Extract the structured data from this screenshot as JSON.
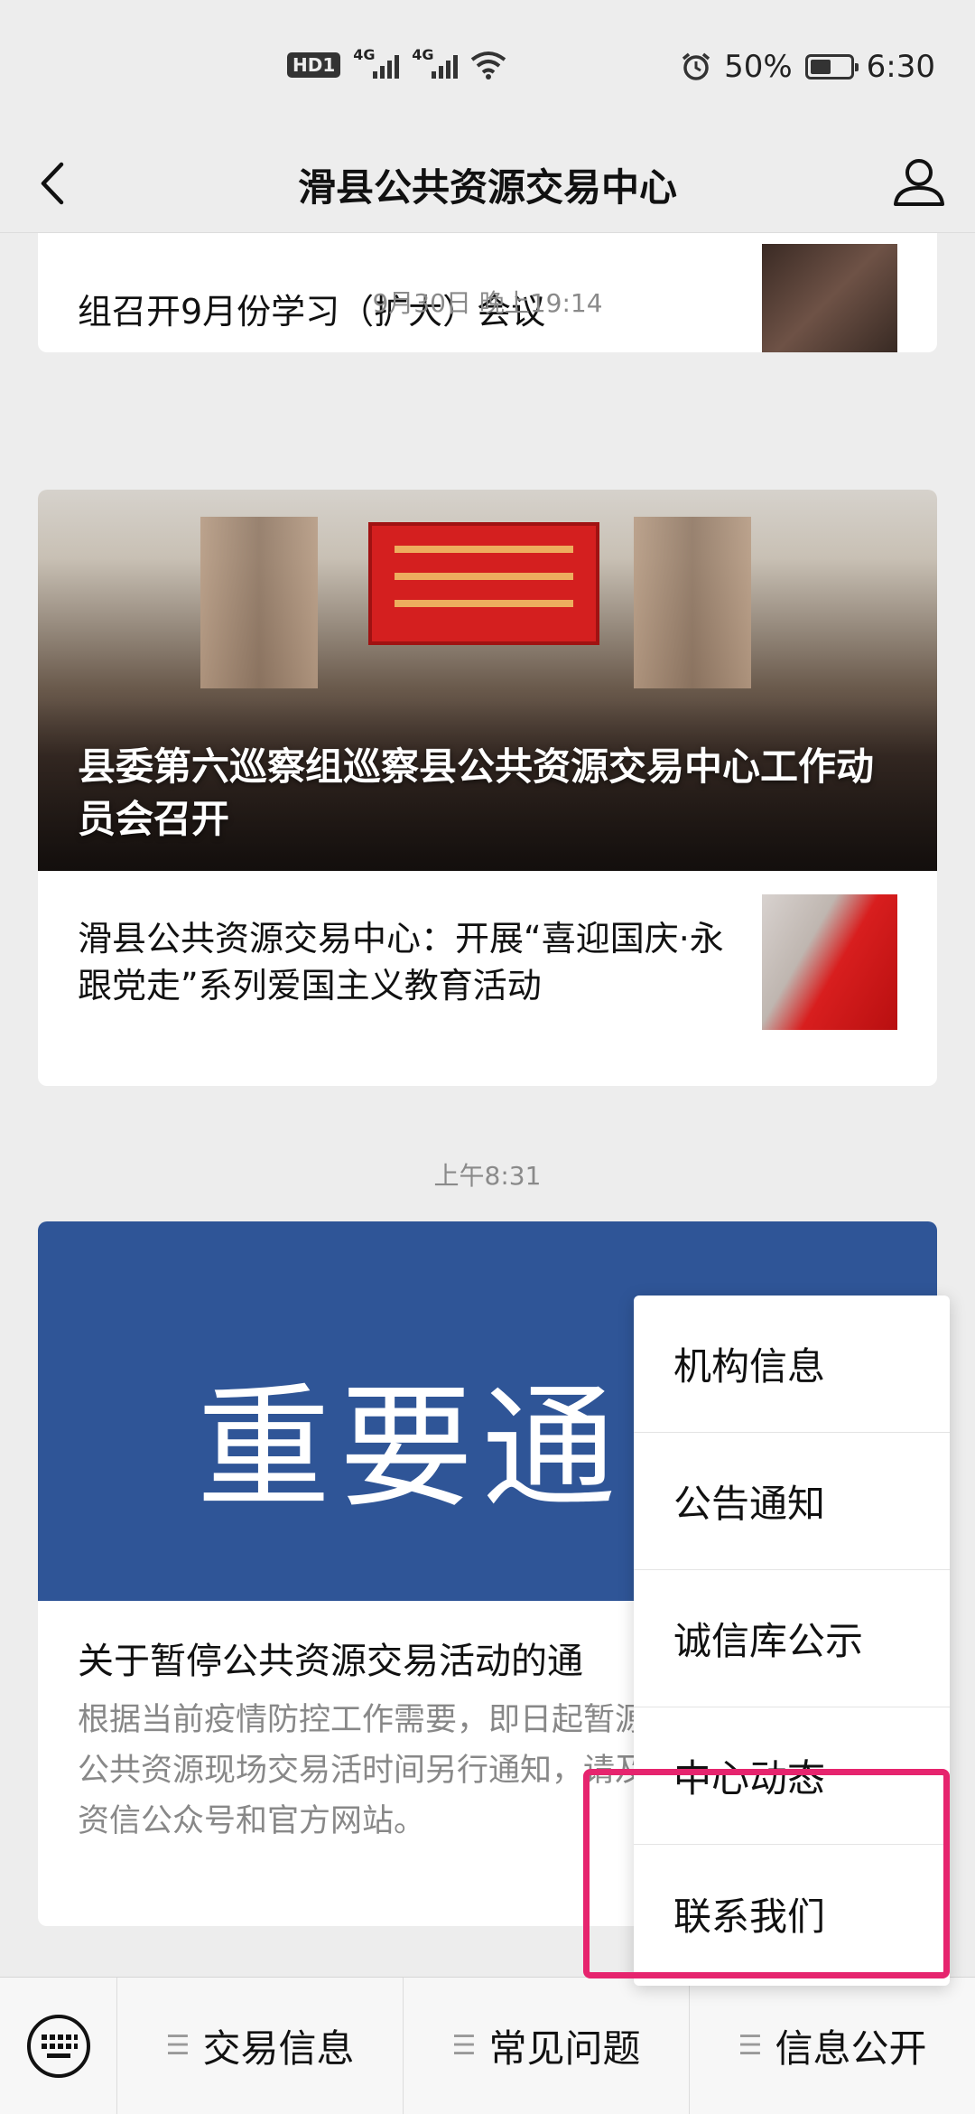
{
  "status_bar": {
    "hd_label": "HD",
    "sim_label": "1",
    "network_1": "4G",
    "network_2": "4G",
    "battery": "50%",
    "battery_level": 0.5,
    "time": "6:30",
    "icons": [
      "signal-icon",
      "wifi-icon",
      "alarm-icon",
      "battery-icon"
    ]
  },
  "nav": {
    "title": "滑县公共资源交易中心"
  },
  "feed": {
    "card1": {
      "title": "组召开9月份学习（扩大）会议"
    },
    "timestamp1": "9月30日 晚上19:14",
    "card2": {
      "hero_caption": "县委第六巡察组巡察县公共资源交易中心工作动员会召开",
      "item_title": "滑县公共资源交易中心：开展“喜迎国庆·永跟党走”系列爱国主义教育活动"
    },
    "timestamp2": "上午8:31",
    "card3": {
      "banner_text": "重要通",
      "title": "关于暂停公共资源交易活动的通",
      "desc": "根据当前疫情防控工作需要，即日起暂源交易平台的各类公共资源现场交易活时间另行通知，请及时关注滑县公共资信公众号和官方网站。"
    }
  },
  "popup_menu": {
    "items": [
      "机构信息",
      "公告通知",
      "诚信库公示",
      "中心动态",
      "联系我们"
    ],
    "highlighted": "联系我们"
  },
  "bottom_bar": {
    "menus": [
      "交易信息",
      "常见问题",
      "信息公开"
    ]
  },
  "colors": {
    "highlight": "#e6246e",
    "notice_blue": "#2f5597"
  }
}
